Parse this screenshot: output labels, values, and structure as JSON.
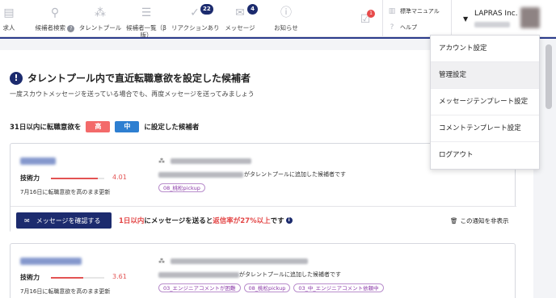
{
  "nav": {
    "items": [
      {
        "label": "求人",
        "icon": "document-icon"
      },
      {
        "label": "候補者検索",
        "icon": "search-icon",
        "help": "?"
      },
      {
        "label": "タレントプール",
        "icon": "people-icon"
      },
      {
        "label": "候補者一覧（β版）",
        "icon": "list-icon"
      },
      {
        "label": "リアクションあり",
        "icon": "check-icon",
        "badge": "22"
      },
      {
        "label": "メッセージ",
        "icon": "mail-icon",
        "badge": "4"
      },
      {
        "label": "お知らせ",
        "icon": "info-icon"
      }
    ],
    "tasks_badge": "1",
    "manual_label": "標準マニュアル",
    "help_label": "ヘルプ",
    "account_name": "LAPRAS Inc."
  },
  "section": {
    "title": "タレントプール内で直近転職意欲を設定した候補者",
    "subtitle": "一度スカウトメッセージを送っている場合でも、再度メッセージを送ってみましょう",
    "filter_prefix": "31日以内に転職意欲を",
    "chip_high": "高",
    "chip_mid": "中",
    "filter_suffix": "に設定した候補者"
  },
  "candidates": [
    {
      "skill_label": "技術力",
      "skill_value": "4.01",
      "skill_fraction": 0.88,
      "updated": "7月16日に転職意欲を高のまま更新",
      "added_suffix": "がタレントプールに追加した候補者です",
      "tags": [
        "08_桃松pickup"
      ]
    },
    {
      "skill_label": "技術力",
      "skill_value": "3.61",
      "skill_fraction": 0.6,
      "updated": "7月16日に転職意欲を高のまま更新",
      "added_suffix": "がタレントプールに追加した候補者です",
      "tags": [
        "03_エンジニアコメントが困難",
        "08_桃松pickup",
        "03_中_エンジニアコメント依頼中"
      ]
    }
  ],
  "card_footer": {
    "button_label": "メッセージを確認する",
    "callout_pre": "1日以内",
    "callout_mid1": "にメッセージを送ると",
    "callout_red": "返信率が27%以上",
    "callout_post": "です",
    "hide_label": "この通知を非表示"
  },
  "dropdown": {
    "items": [
      "アカウント設定",
      "管理設定",
      "メッセージテンプレート設定",
      "コメントテンプレート設定",
      "ログアウト"
    ],
    "active_index": 1
  },
  "colors": {
    "brand_navy": "#1c2b6e",
    "high_red": "#f36a6a",
    "mid_blue": "#2e7fd1",
    "skill_red": "#e35353"
  }
}
